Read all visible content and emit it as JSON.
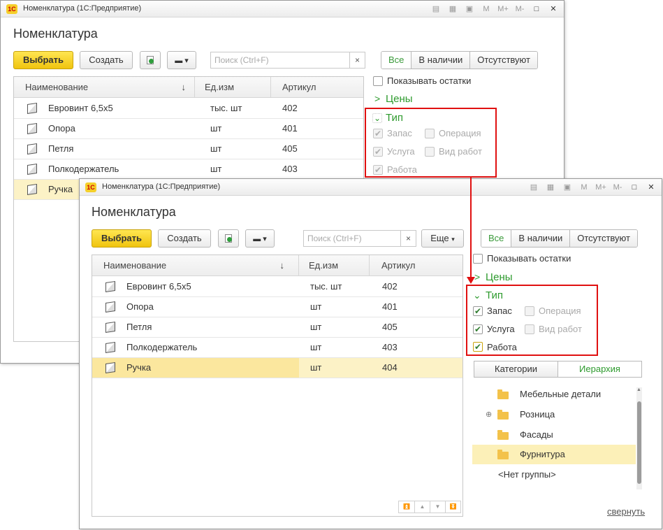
{
  "colors": {
    "accent_green": "#2d9a2d",
    "highlight_red": "#e01010",
    "select_yellow": "#fcf2c6",
    "primary_button": "#f0c40f"
  },
  "back": {
    "window_title": "Номенклатура  (1С:Предприятие)",
    "heading": "Номенклатура",
    "toolbar": {
      "select": "Выбрать",
      "create": "Создать",
      "search_placeholder": "Поиск (Ctrl+F)",
      "clear": "×"
    },
    "filter_tabs": [
      "Все",
      "В наличии",
      "Отсутствуют"
    ],
    "show_stock": "Показывать остатки",
    "prices": "Цены",
    "type": {
      "title": "Тип",
      "options": [
        "Запас",
        "Операция",
        "Услуга",
        "Вид работ",
        "Работа"
      ]
    },
    "columns": [
      "Наименование",
      "Ед.изм",
      "Артикул"
    ],
    "rows": [
      {
        "name": "Евровинт 6,5x5",
        "unit": "тыс. шт",
        "code": "402"
      },
      {
        "name": "Опора",
        "unit": "шт",
        "code": "401"
      },
      {
        "name": "Петля",
        "unit": "шт",
        "code": "405"
      },
      {
        "name": "Полкодержатель",
        "unit": "шт",
        "code": "403"
      },
      {
        "name": "Ручка",
        "unit": "",
        "code": ""
      }
    ]
  },
  "front": {
    "window_title": "Номенклатура  (1С:Предприятие)",
    "heading": "Номенклатура",
    "toolbar": {
      "select": "Выбрать",
      "create": "Создать",
      "search_placeholder": "Поиск (Ctrl+F)",
      "clear": "×",
      "more": "Еще"
    },
    "filter_tabs": [
      "Все",
      "В наличии",
      "Отсутствуют"
    ],
    "show_stock": "Показывать остатки",
    "prices": "Цены",
    "type": {
      "title": "Тип",
      "options": [
        "Запас",
        "Операция",
        "Услуга",
        "Вид работ",
        "Работа"
      ]
    },
    "columns": [
      "Наименование",
      "Ед.изм",
      "Артикул"
    ],
    "rows": [
      {
        "name": "Евровинт 6,5x5",
        "unit": "тыс. шт",
        "code": "402"
      },
      {
        "name": "Опора",
        "unit": "шт",
        "code": "401"
      },
      {
        "name": "Петля",
        "unit": "шт",
        "code": "405"
      },
      {
        "name": "Полкодержатель",
        "unit": "шт",
        "code": "403"
      },
      {
        "name": "Ручка",
        "unit": "шт",
        "code": "404"
      }
    ],
    "view_tabs": [
      "Категории",
      "Иерархия"
    ],
    "tree": [
      "Мебельные детали",
      "Розница",
      "Фасады",
      "Фурнитура",
      "<Нет группы>"
    ],
    "collapse": "свернуть"
  }
}
